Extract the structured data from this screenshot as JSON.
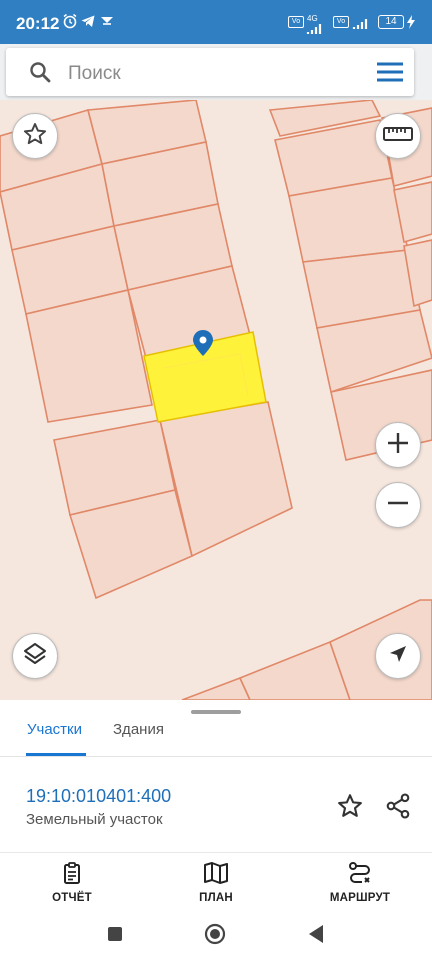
{
  "status_bar": {
    "time": "20:12",
    "network": "4G",
    "battery": "14"
  },
  "search": {
    "placeholder": "Поиск"
  },
  "map": {
    "selected_parcel_color": "#fff23a",
    "parcel_fill_color": "#f3d9cd",
    "parcel_line_color": "#e08868",
    "marker_color": "#1f6fb8"
  },
  "bottom_sheet": {
    "tabs": [
      {
        "label": "Участки",
        "active": true
      },
      {
        "label": "Здания",
        "active": false
      }
    ],
    "parcel": {
      "cadastral_number": "19:10:010401:400",
      "type": "Земельный участок"
    }
  },
  "bottom_nav": {
    "items": [
      {
        "label": "ОТЧЁТ",
        "icon": "report-icon"
      },
      {
        "label": "ПЛАН",
        "icon": "map-plan-icon"
      },
      {
        "label": "МАРШРУТ",
        "icon": "route-icon"
      }
    ]
  },
  "colors": {
    "status_bar": "#2f7fc2",
    "accent": "#1976d2"
  }
}
